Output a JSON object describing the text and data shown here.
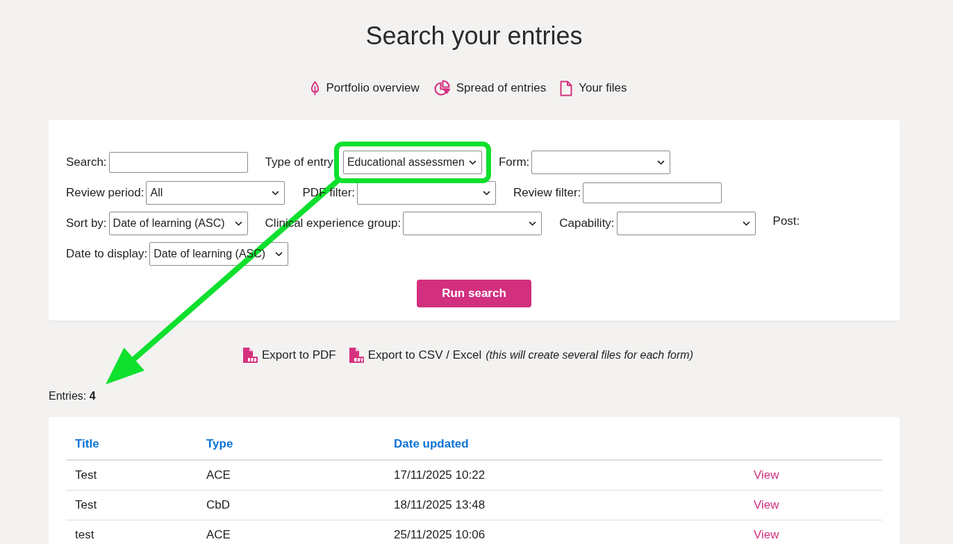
{
  "page": {
    "title": "Search your entries"
  },
  "nav_links": [
    {
      "kind": "overview",
      "label": "Portfolio overview"
    },
    {
      "kind": "spread",
      "label": "Spread of entries"
    },
    {
      "kind": "files",
      "label": "Your files"
    }
  ],
  "filters": [
    [
      {
        "kind": "text",
        "label": "Search:",
        "highlighted": false
      },
      {
        "kind": "select",
        "label": "Type of entry",
        "value": "Educational assessmen",
        "highlighted": true
      },
      {
        "kind": "select",
        "label": "Form:",
        "highlighted": false
      }
    ],
    [
      {
        "kind": "select",
        "label": "Review period:",
        "value": "All",
        "highlighted": false
      },
      {
        "kind": "select",
        "label": "PDF filter:",
        "highlighted": false
      },
      {
        "kind": "text",
        "label": "Review filter:",
        "highlighted": false
      }
    ],
    [
      {
        "kind": "select",
        "label": "Sort by:",
        "value": "Date of learning (ASC)",
        "highlighted": false
      },
      {
        "kind": "select",
        "label": "Clinical experience group:",
        "highlighted": false
      },
      {
        "kind": "select",
        "label": "Capability:",
        "highlighted": false
      },
      {
        "kind": "label",
        "label": "Post:",
        "highlighted": false
      }
    ],
    [
      {
        "kind": "select",
        "label": "Date to display:",
        "value": "Date of learning (ASC)",
        "highlighted": false
      }
    ]
  ],
  "run_button": {
    "label": "Run search"
  },
  "exports": [
    {
      "kind": "pdf",
      "label": "Export to PDF"
    },
    {
      "kind": "csv",
      "label": "Export to CSV / Excel",
      "note": "(this will create several files for each form)"
    }
  ],
  "entries_summary": "Entries: **4**",
  "table": {
    "columns": [
      "Title",
      "Type",
      "Date updated"
    ],
    "rows": [
      {
        "cells": [
          "Test",
          "ACE",
          "17/11/2025 10:22"
        ],
        "action": "View"
      },
      {
        "cells": [
          "Test",
          "CbD",
          "18/11/2025 13:48"
        ],
        "action": "View"
      },
      {
        "cells": [
          "test",
          "ACE",
          "25/11/2025 10:06"
        ],
        "action": "View"
      }
    ]
  }
}
